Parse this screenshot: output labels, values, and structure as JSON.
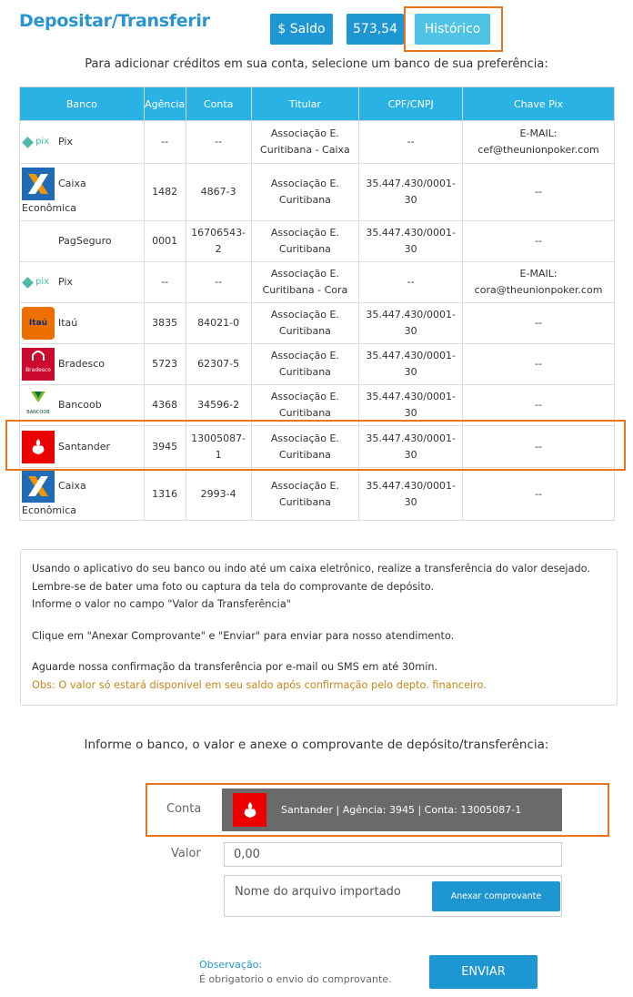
{
  "header": {
    "title": "Depositar/Transferir",
    "saldo_label": "$ Saldo",
    "saldo_value": "573,54",
    "historico_label": "Histórico"
  },
  "instructions": "Para adicionar créditos em sua conta, selecione um banco de sua preferência:",
  "table": {
    "headers": [
      "Banco",
      "Agência",
      "Conta",
      "Titular",
      "CPF/CNPJ",
      "Chave Pix"
    ],
    "rows": [
      {
        "bank": "Pix",
        "logo": "pix-icon",
        "agencia": "--",
        "conta": "--",
        "titular_l1": "Associação E.",
        "titular_l2": "Curitibana - Caixa",
        "cpf": "--",
        "pix_l1": "E-MAIL:",
        "pix_l2": "cef@theunionpoker.com"
      },
      {
        "bank_l1": "Caixa",
        "bank_l2": "Econômica",
        "logo": "caixa-icon",
        "agencia": "1482",
        "conta": "4867-3",
        "titular_l1": "Associação E.",
        "titular_l2": "Curitibana",
        "cpf": "35.447.430/0001-30",
        "pix": "--"
      },
      {
        "bank": "PagSeguro",
        "agencia": "0001",
        "conta": "16706543-2",
        "titular_l1": "Associação E.",
        "titular_l2": "Curitibana",
        "cpf": "35.447.430/0001-30",
        "pix": "--"
      },
      {
        "bank": "Pix",
        "logo": "pix-icon",
        "agencia": "--",
        "conta": "--",
        "titular_l1": "Associação E.",
        "titular_l2": "Curitibana - Cora",
        "cpf": "--",
        "pix_l1": "E-MAIL:",
        "pix_l2": "cora@theunionpoker.com"
      },
      {
        "bank": "Itaú",
        "logo": "itau-icon",
        "logo_text": "Itaú",
        "agencia": "3835",
        "conta": "84021-0",
        "titular_l1": "Associação E.",
        "titular_l2": "Curitibana",
        "cpf": "35.447.430/0001-30",
        "pix": "--"
      },
      {
        "bank": "Bradesco",
        "logo": "bradesco-icon",
        "logo_text": "Bradesco",
        "agencia": "5723",
        "conta": "62307-5",
        "titular_l1": "Associação E.",
        "titular_l2": "Curitibana",
        "cpf": "35.447.430/0001-30",
        "pix": "--"
      },
      {
        "bank": "Bancoob",
        "logo": "bancoob-icon",
        "logo_text": "BANCOOB",
        "agencia": "4368",
        "conta": "34596-2",
        "titular_l1": "Associação E.",
        "titular_l2": "Curitibana",
        "cpf": "35.447.430/0001-30",
        "pix": "--"
      },
      {
        "bank": "Santander",
        "logo": "santander-icon",
        "agencia": "3945",
        "conta": "13005087-1",
        "titular_l1": "Associação E.",
        "titular_l2": "Curitibana",
        "cpf": "35.447.430/0001-30",
        "pix": "--"
      },
      {
        "bank_l1": "Caixa",
        "bank_l2": "Econômica",
        "logo": "caixa-icon",
        "agencia": "1316",
        "conta": "2993-4",
        "titular_l1": "Associação E.",
        "titular_l2": "Curitibana",
        "cpf": "35.447.430/0001-30",
        "pix": "--"
      }
    ]
  },
  "info": {
    "line1": "Usando o aplicativo do seu banco ou indo até um caixa eletrônico, realize a transferência do valor desejado.",
    "line2": "Lembre-se de bater uma foto ou captura da tela do comprovante de depósito.",
    "line3": "Informe o valor no campo \"Valor da Transferência\"",
    "line4": "Clique em \"Anexar Comprovante\" e \"Enviar\" para enviar para nosso atendimento.",
    "line5": "Aguarde nossa confirmação da transferência por e-mail ou SMS em até 30min.",
    "obs": "Obs: O valor só estará disponível em seu saldo após confirmação pelo depto. financeiro."
  },
  "form": {
    "title": "Informe o banco, o valor e anexe o comprovante de depósito/transferência:",
    "conta_label": "Conta",
    "conta_value": "Santander | Agência: 3945 | Conta: 13005087-1",
    "valor_label": "Valor",
    "valor_value": "0,00",
    "file_label": "Nome do arquivo importado",
    "anexar_label": "Anexar comprovante",
    "obs_label": "Observação:",
    "obs_text": "É obrigatorio o envio do comprovante.",
    "enviar_label": "ENVIAR"
  },
  "colors": {
    "accent": "#1e96d2",
    "header_bg": "#29b2e3",
    "highlight": "#e9741e",
    "obs_text": "#c8861a"
  }
}
